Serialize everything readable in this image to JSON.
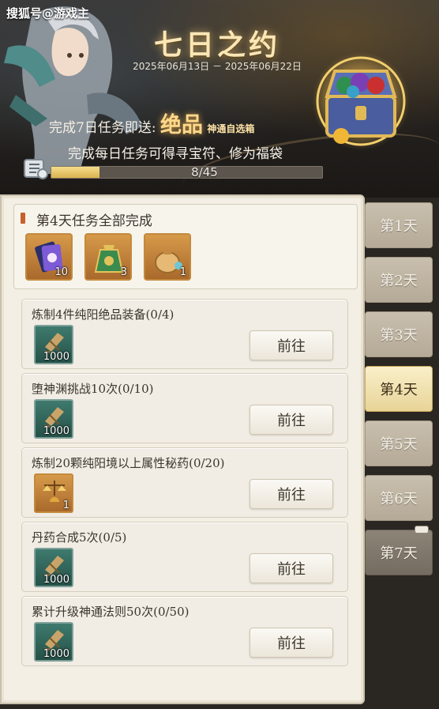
{
  "watermark": "搜狐号@游戏主",
  "event": {
    "title": "七日之约",
    "date_start": "2025年06月13日",
    "date_separator": "－",
    "date_end": "2025年06月22日",
    "reward_prefix": "完成7日任务即送:",
    "reward_big": "绝品",
    "reward_small": "神通自选箱",
    "reward_line2": "完成每日任务可得寻宝符、修为福袋",
    "chest_icon": "treasure-chest-icon"
  },
  "progress": {
    "current": 8,
    "total": 45,
    "text": "8/45",
    "fill_fraction": 0.178
  },
  "summary": {
    "title": "第4天任务全部完成",
    "rewards": [
      {
        "icon": "treasure-talisman-icon",
        "count": "10"
      },
      {
        "icon": "green-pouch-icon",
        "count": "3"
      },
      {
        "icon": "cultivation-bag-icon",
        "count": "1"
      }
    ]
  },
  "tasks": [
    {
      "title": "炼制4件纯阳绝品装备(0/4)",
      "reward_icon": "cultivation-scroll-icon",
      "reward_count": "1000",
      "button": "前往"
    },
    {
      "title": "堕神渊挑战10次(0/10)",
      "reward_icon": "cultivation-scroll-icon",
      "reward_count": "1000",
      "button": "前往"
    },
    {
      "title": "炼制20颗纯阳境以上属性秘药(0/20)",
      "reward_icon": "scale-bell-icon",
      "reward_count": "1",
      "button": "前往"
    },
    {
      "title": "丹药合成5次(0/5)",
      "reward_icon": "cultivation-scroll-icon",
      "reward_count": "1000",
      "button": "前往"
    },
    {
      "title": "累计升级神通法则50次(0/50)",
      "reward_icon": "cultivation-scroll-icon",
      "reward_count": "1000",
      "button": "前往"
    }
  ],
  "days": [
    {
      "label": "第1天",
      "state": "normal"
    },
    {
      "label": "第2天",
      "state": "normal"
    },
    {
      "label": "第3天",
      "state": "normal"
    },
    {
      "label": "第4天",
      "state": "active"
    },
    {
      "label": "第5天",
      "state": "normal"
    },
    {
      "label": "第6天",
      "state": "normal"
    },
    {
      "label": "第7天",
      "state": "locked"
    }
  ],
  "colors": {
    "accent_gold": "#ffd88a",
    "panel_bg": "#f3efe4",
    "progress_fill": "#e3c062"
  }
}
